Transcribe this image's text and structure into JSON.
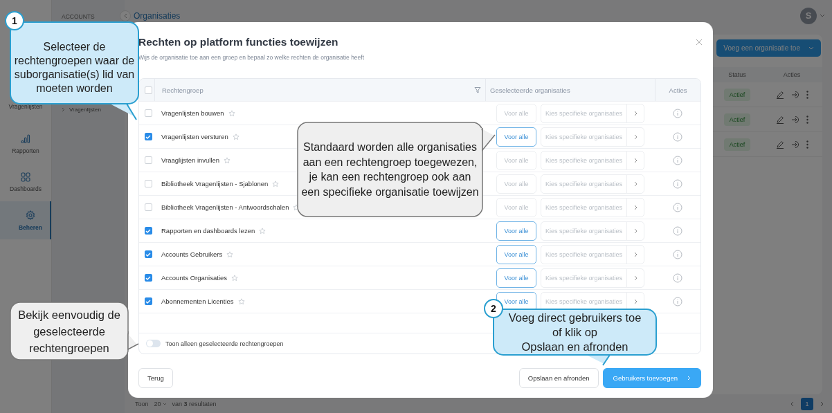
{
  "app_sidebar": {
    "items": [
      {
        "label": "Vragenlijsten",
        "selected": false
      },
      {
        "label": "Rapporten",
        "selected": false
      },
      {
        "label": "Dashboards",
        "selected": false
      },
      {
        "label": "Beheren",
        "selected": true
      }
    ]
  },
  "sub_nav": {
    "section": "ACCOUNTS",
    "items": [
      {
        "label": "Vragenlijsten"
      }
    ]
  },
  "breadcrumb": {
    "current": "Organisaties"
  },
  "user": {
    "initial": "S"
  },
  "organisations": {
    "add_button": "Voeg een organisatie toe",
    "columns": [
      "Status",
      "Acties"
    ],
    "rows": [
      {
        "status": "Actief"
      },
      {
        "status": "Actief"
      },
      {
        "status": "Actief"
      }
    ]
  },
  "list_footer": {
    "show_label": "Toon",
    "page_size": "20",
    "results": "van **3** resultaten",
    "pages": [
      {
        "label": "1",
        "selected": true
      }
    ]
  },
  "modal": {
    "title": "Rechten op platform functies toewijzen",
    "subtitle": "Wijs de organisatie toe aan een groep en bepaal zo welke rechten de organisatie heeft",
    "table": {
      "columns": [
        "Rechtengroep",
        "Geselecteerde organisaties",
        "Acties"
      ],
      "all_checked": false,
      "rows": [
        {
          "name": "Vragenlijsten bouwen",
          "checked": false,
          "for_all": "Voor alle",
          "for_all_selected": false,
          "specific": "Kies specifieke organisaties"
        },
        {
          "name": "Vragenlijsten versturen",
          "checked": true,
          "for_all": "Voor alle",
          "for_all_selected": true,
          "specific": "Kies specifieke organisaties"
        },
        {
          "name": "Vraaglijsten invullen",
          "checked": false,
          "for_all": "Voor alle",
          "for_all_selected": false,
          "specific": "Kies specifieke organisaties"
        },
        {
          "name": "Bibliotheek Vragenlijsten - Sjablonen",
          "checked": false,
          "for_all": "Voor alle",
          "for_all_selected": false,
          "specific": "Kies specifieke organisaties"
        },
        {
          "name": "Bibliotheek Vragenlijsten - Antwoordschalen",
          "checked": false,
          "for_all": "Voor alle",
          "for_all_selected": false,
          "specific": "Kies specifieke organisaties"
        },
        {
          "name": "Rapporten en dashboards lezen",
          "checked": true,
          "for_all": "Voor alle",
          "for_all_selected": true,
          "specific": "Kies specifieke organisaties"
        },
        {
          "name": "Accounts Gebruikers",
          "checked": true,
          "for_all": "Voor alle",
          "for_all_selected": true,
          "specific": "Kies specifieke organisaties"
        },
        {
          "name": "Accounts Organisaties",
          "checked": true,
          "for_all": "Voor alle",
          "for_all_selected": true,
          "specific": "Kies specifieke organisaties"
        },
        {
          "name": "Abonnementen Licenties",
          "checked": true,
          "for_all": "Voor alle",
          "for_all_selected": true,
          "specific": "Kies specifieke organisaties"
        }
      ]
    },
    "filter_toggle": {
      "label": "Toon alleen geselecteerde rechtengroepen",
      "on": false
    },
    "buttons": [
      {
        "label": "Terug",
        "kind": "secondary"
      },
      {
        "label": "Opslaan en afronden",
        "kind": "secondary"
      },
      {
        "label": "Gebruikers toevoegen",
        "kind": "primary"
      }
    ]
  },
  "callouts": [
    {
      "kind": "blue",
      "number": "1",
      "text": "Selecteer de rechtengroepen waar de suborganisatie(s) lid van moeten worden"
    },
    {
      "kind": "gray",
      "text": "Standaard worden alle organisaties aan een rechtengroep toegewezen, je kan een rechtengroep ook aan een specifieke organisatie toewijzen"
    },
    {
      "kind": "gray",
      "text": "Bekijk eenvoudig de geselecteerde rechtengroepen"
    },
    {
      "kind": "blue",
      "number": "2",
      "text": "Voeg direct gebruikers toe\nof klik op\nOpslaan en afronden"
    }
  ]
}
